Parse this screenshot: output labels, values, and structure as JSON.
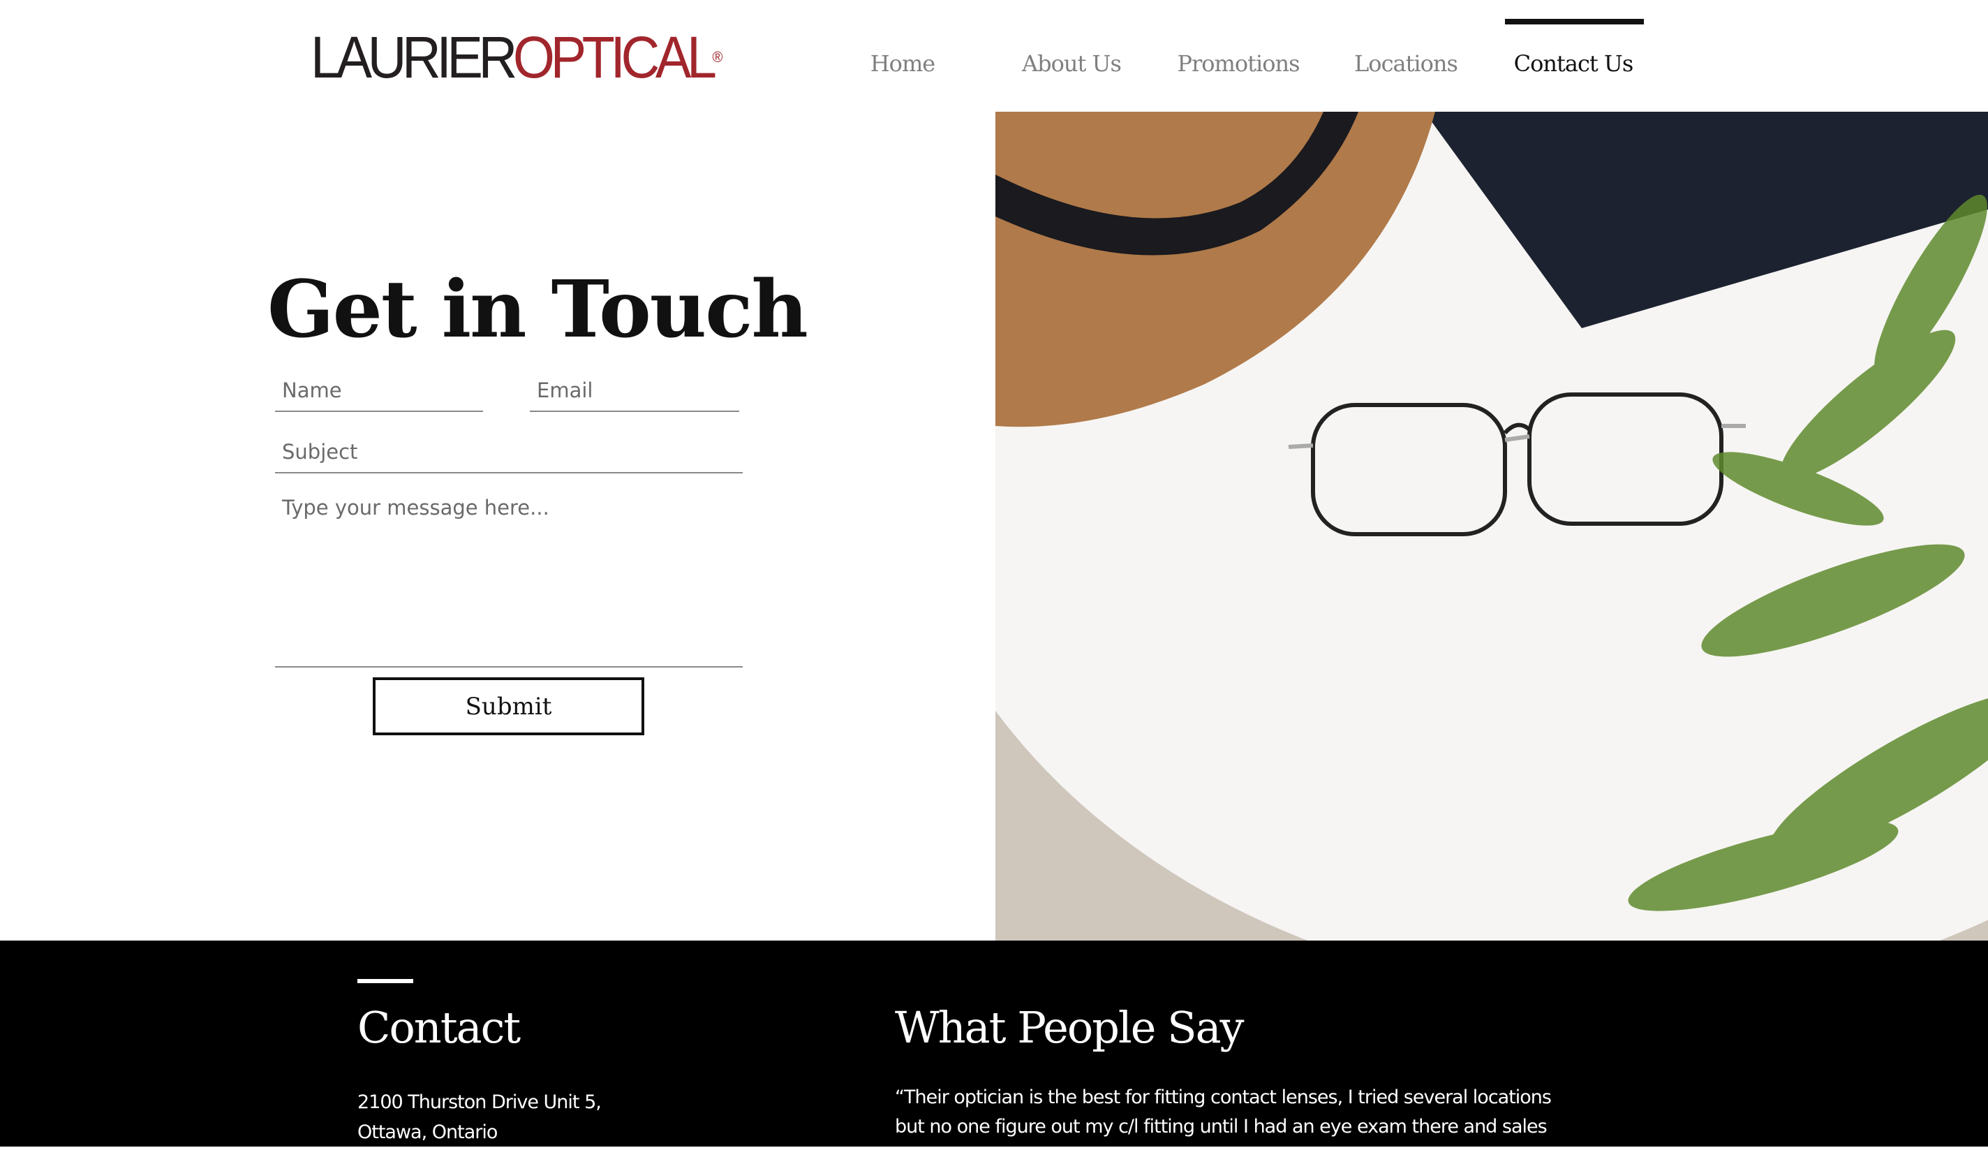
{
  "header": {
    "logo_dark": "LAURIER",
    "logo_red": "OPTICAL",
    "logo_mark": "®",
    "nav": [
      {
        "label": "Home"
      },
      {
        "label": "About Us"
      },
      {
        "label": "Promotions"
      },
      {
        "label": "Locations"
      },
      {
        "label": "Contact Us",
        "active": true
      }
    ]
  },
  "form": {
    "title": "Get in Touch",
    "name_placeholder": "Name",
    "email_placeholder": "Email",
    "subject_placeholder": "Subject",
    "message_placeholder": "Type your message here...",
    "submit_label": "Submit"
  },
  "footer": {
    "contact_title": "Contact",
    "address_line1": "2100 Thurston Drive Unit 5,",
    "address_line2": "Ottawa, Ontario",
    "testimonials_title": "What People Say",
    "quote": "“Their optician is the best for fitting contact lenses, I tried several locations but no one figure out my c/l fitting until I had an eye exam there and sales associate mentioned"
  },
  "colors": {
    "brand_red": "#a1262c",
    "footer_bg": "#000000"
  }
}
